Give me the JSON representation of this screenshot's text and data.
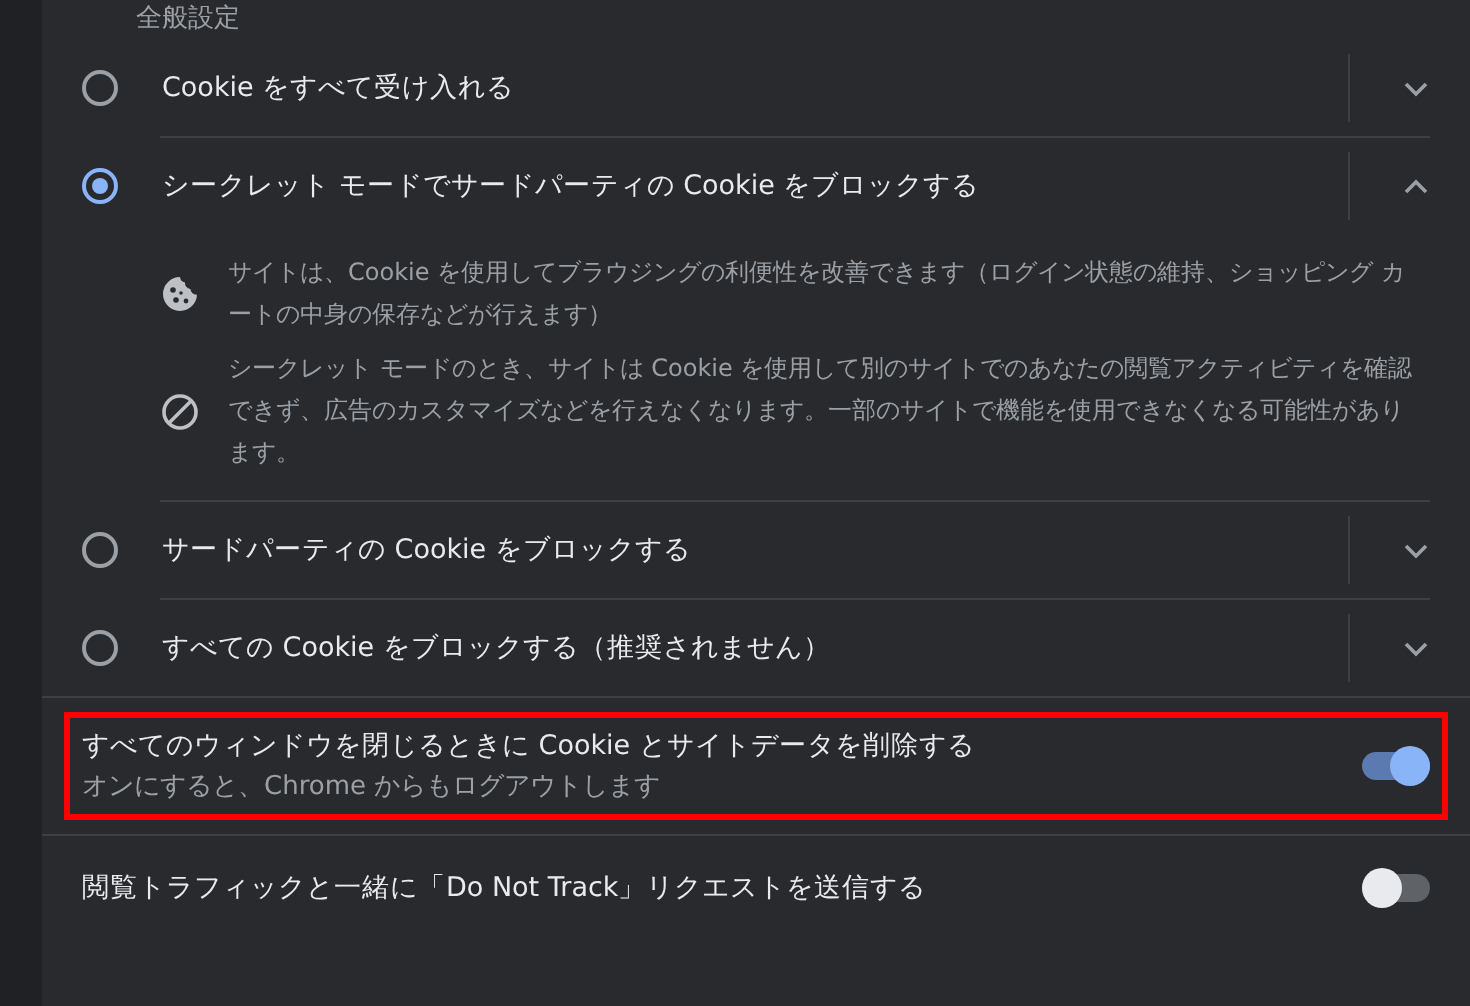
{
  "section_title": "全般設定",
  "cookie_options": [
    {
      "label": "Cookie をすべて受け入れる",
      "selected": false,
      "expanded": false
    },
    {
      "label": "シークレット モードでサードパーティの Cookie をブロックする",
      "selected": true,
      "expanded": true,
      "details": [
        {
          "kind": "cookie",
          "text": "サイトは、Cookie を使用してブラウジングの利便性を改善できます（ログイン状態の維持、ショッピング カートの中身の保存などが行えます）"
        },
        {
          "kind": "block",
          "text": "シークレット モードのとき、サイトは Cookie を使用して別のサイトでのあなたの閲覧アクティビティを確認できず、広告のカスタマイズなどを行えなくなります。一部のサイトで機能を使用できなくなる可能性があります。"
        }
      ]
    },
    {
      "label": "サードパーティの Cookie をブロックする",
      "selected": false,
      "expanded": false
    },
    {
      "label": "すべての Cookie をブロックする（推奨されません）",
      "selected": false,
      "expanded": false
    }
  ],
  "toggles": [
    {
      "label": "すべてのウィンドウを閉じるときに Cookie とサイトデータを削除する",
      "sublabel": "オンにすると、Chrome からもログアウトします",
      "on": true,
      "highlighted": true
    },
    {
      "label": "閲覧トラフィックと一緒に「Do Not Track」リクエストを送信する",
      "on": false,
      "highlighted": false
    }
  ]
}
